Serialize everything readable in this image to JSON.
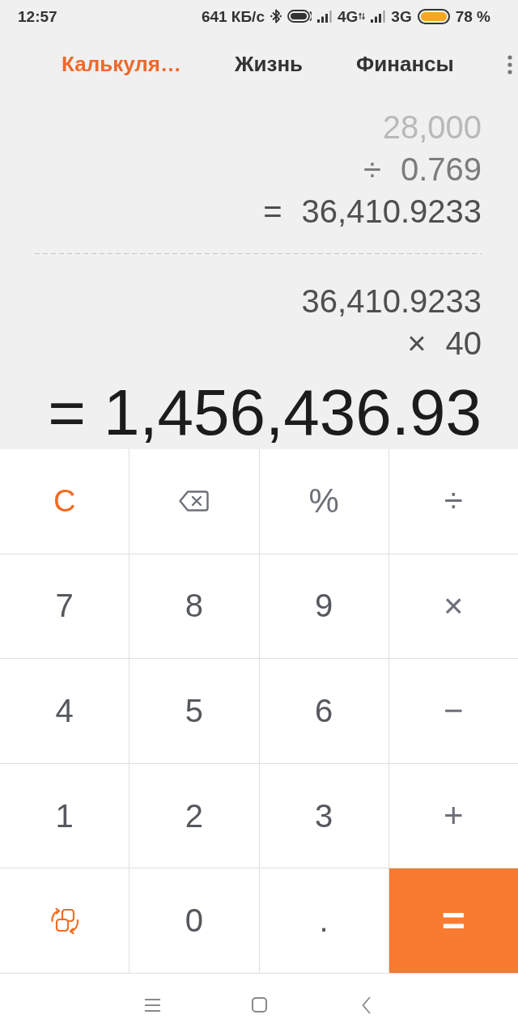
{
  "status_bar": {
    "time": "12:57",
    "speed": "641 КБ/с",
    "network_1": "4G",
    "network_2": "3G",
    "battery": "78 %"
  },
  "tabs": [
    {
      "label": "Калькуля…",
      "selected": true
    },
    {
      "label": "Жизнь",
      "selected": false
    },
    {
      "label": "Финансы",
      "selected": false
    }
  ],
  "display": {
    "history": [
      {
        "value": "28,000"
      },
      {
        "operator": "÷",
        "value": "0.769"
      },
      {
        "operator": "=",
        "value": "36,410.9233"
      }
    ],
    "current": [
      {
        "value": "36,410.9233"
      },
      {
        "operator": "×",
        "value": "40"
      }
    ],
    "result": {
      "operator": "=",
      "value": "1,456,436.93"
    }
  },
  "keys": [
    {
      "kind": "clear",
      "label": "C"
    },
    {
      "kind": "backspace"
    },
    {
      "kind": "operator",
      "label": "%"
    },
    {
      "kind": "operator",
      "label": "÷"
    },
    {
      "kind": "digit",
      "label": "7"
    },
    {
      "kind": "digit",
      "label": "8"
    },
    {
      "kind": "digit",
      "label": "9"
    },
    {
      "kind": "operator",
      "label": "×"
    },
    {
      "kind": "digit",
      "label": "4"
    },
    {
      "kind": "digit",
      "label": "5"
    },
    {
      "kind": "digit",
      "label": "6"
    },
    {
      "kind": "operator",
      "label": "−"
    },
    {
      "kind": "digit",
      "label": "1"
    },
    {
      "kind": "digit",
      "label": "2"
    },
    {
      "kind": "digit",
      "label": "3"
    },
    {
      "kind": "operator",
      "label": "+"
    },
    {
      "kind": "convert"
    },
    {
      "kind": "digit",
      "label": "0"
    },
    {
      "kind": "digit",
      "label": "."
    },
    {
      "kind": "equals",
      "label": "="
    }
  ]
}
